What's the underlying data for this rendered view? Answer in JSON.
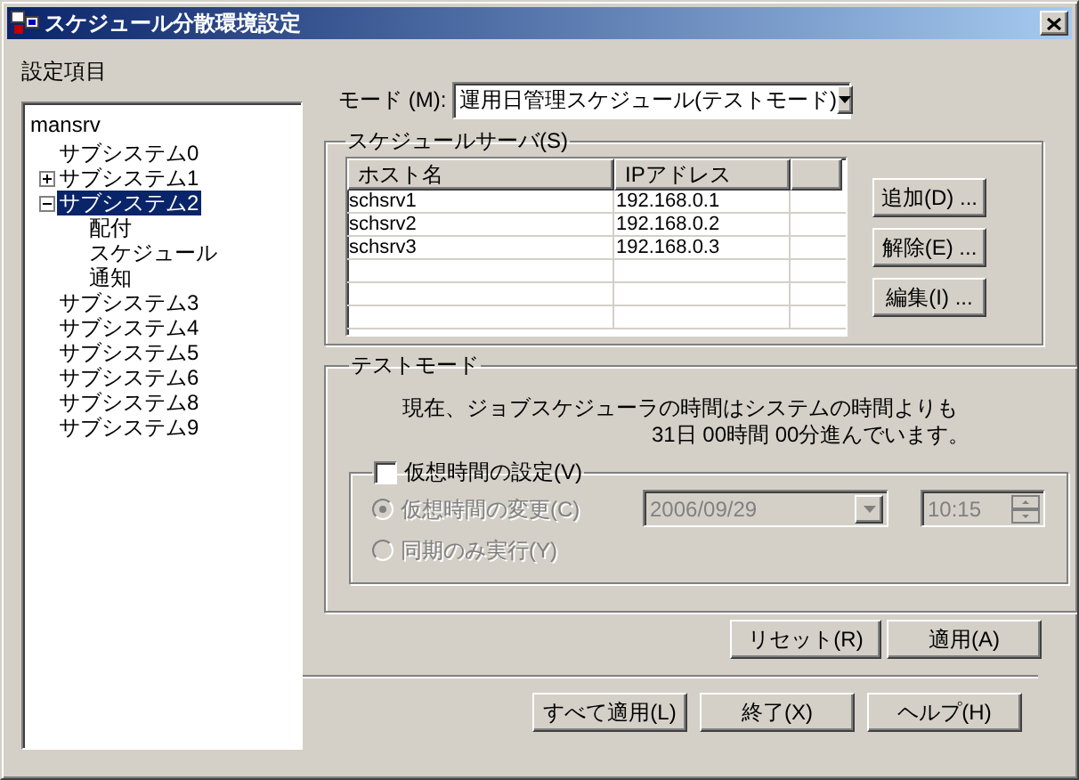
{
  "window": {
    "title": "スケジュール分散環境設定"
  },
  "settings_label": "設定項目",
  "tree": [
    {
      "label": "mansrv",
      "selected": false,
      "children": [
        {
          "label": "サブシステム0",
          "selected": false
        },
        {
          "label": "サブシステム1",
          "selected": false,
          "expanded": false
        },
        {
          "label": "サブシステム2",
          "selected": true,
          "expanded": true,
          "children": [
            {
              "label": "配付",
              "selected": false
            },
            {
              "label": "スケジュール",
              "selected": false
            },
            {
              "label": "通知",
              "selected": false
            }
          ]
        },
        {
          "label": "サブシステム3",
          "selected": false
        },
        {
          "label": "サブシステム4",
          "selected": false
        },
        {
          "label": "サブシステム5",
          "selected": false
        },
        {
          "label": "サブシステム6",
          "selected": false
        },
        {
          "label": "サブシステム8",
          "selected": false
        },
        {
          "label": "サブシステム9",
          "selected": false
        }
      ]
    }
  ],
  "mode": {
    "label": "モード (M):",
    "value": "運用日管理スケジュール(テストモード)"
  },
  "schedule_servers": {
    "title": "スケジュールサーバ(S)",
    "columns": [
      "ホスト名",
      "IPアドレス"
    ],
    "rows": [
      [
        "schsrv1",
        "192.168.0.1"
      ],
      [
        "schsrv2",
        "192.168.0.2"
      ],
      [
        "schsrv3",
        "192.168.0.3"
      ]
    ],
    "buttons": [
      "追加(D) ...",
      "解除(E) ...",
      "編集(I) ..."
    ]
  },
  "test_mode": {
    "title": "テストモード",
    "message_lines": [
      "現在、ジョブスケジューラの時間はシステムの時間よりも",
      "31日 00時間 00分進んでいます。"
    ],
    "virtual_time": {
      "label": "仮想時間の設定(V)",
      "checked": false,
      "options": [
        {
          "label": "仮想時間の変更(C)",
          "selected": true,
          "disabled": true
        },
        {
          "label": "同期のみ実行(Y)",
          "selected": false,
          "disabled": true
        }
      ],
      "date": {
        "value": "2006/09/29",
        "disabled": true
      },
      "time": {
        "value": "10:15",
        "disabled": true
      }
    }
  },
  "section_buttons": [
    "リセット(R)",
    "適用(A)"
  ],
  "footer_buttons": [
    "すべて適用(L)",
    "終了(X)",
    "ヘルプ(H)"
  ]
}
